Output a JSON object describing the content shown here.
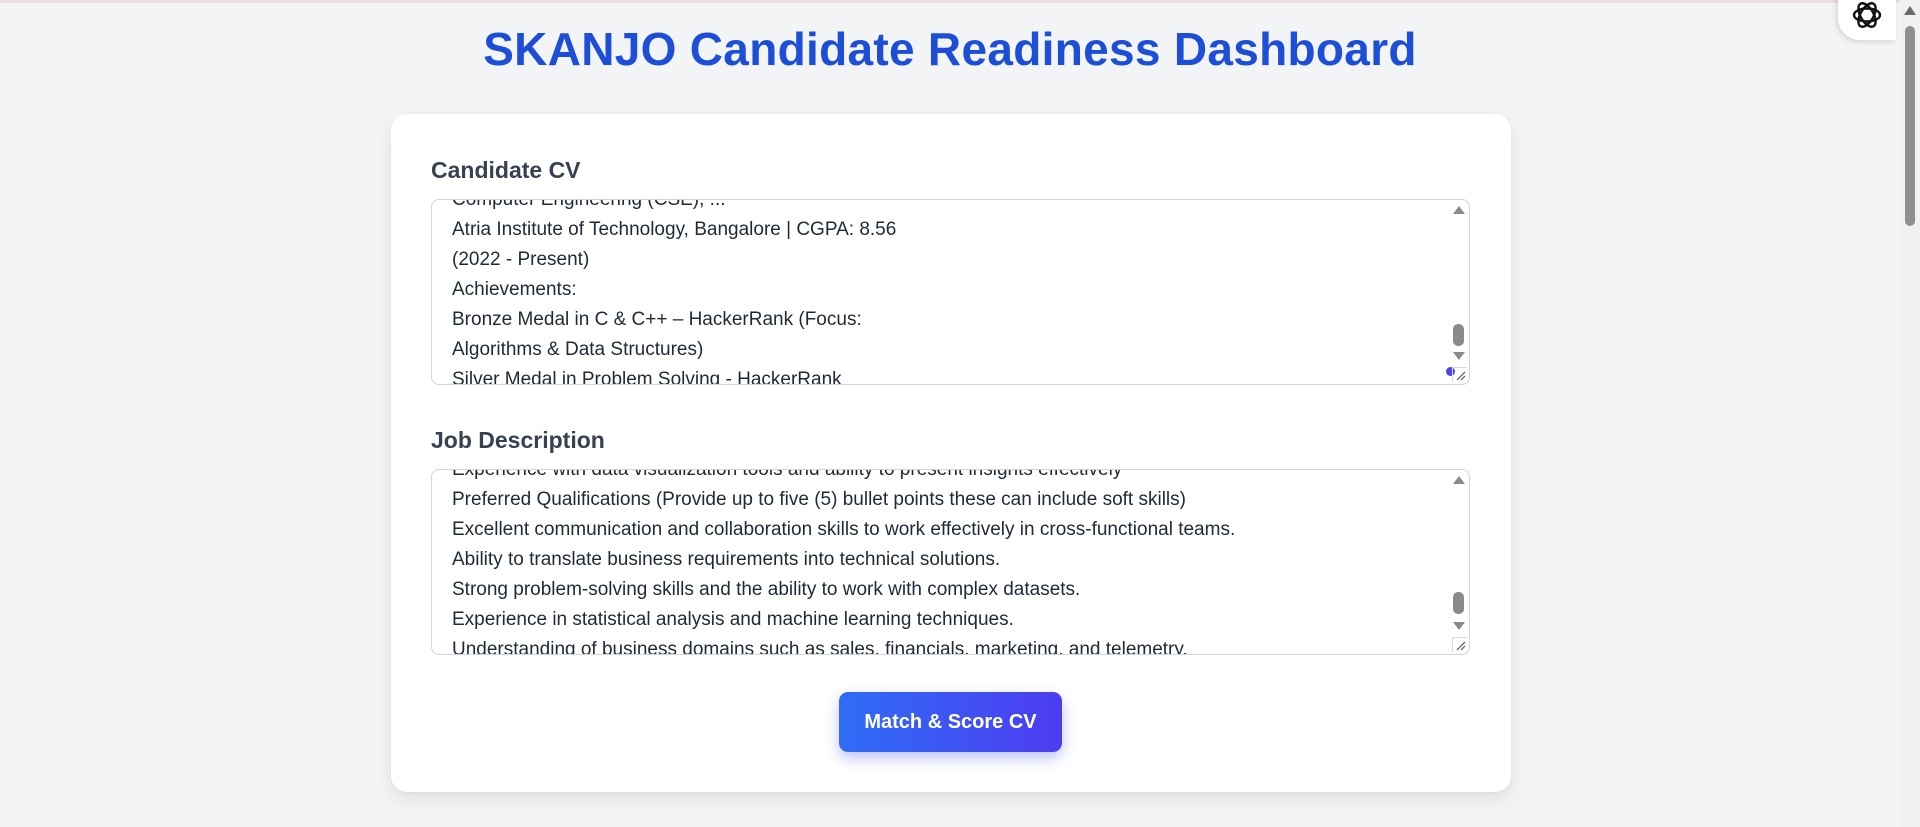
{
  "page": {
    "title": "SKANJO Candidate Readiness Dashboard"
  },
  "cv": {
    "label": "Candidate CV",
    "partial_top_line": "Computer Engineering (CSE), ...",
    "lines": [
      "Atria Institute of Technology, Bangalore | CGPA: 8.56",
      "(2022 - Present)",
      "Achievements:",
      "Bronze Medal in C & C++ – HackerRank (Focus:",
      "Algorithms & Data Structures)"
    ],
    "last_line_prefix": "Silver Medal in Problem Solving - ",
    "last_line_misspelled": "HackerRank"
  },
  "jd": {
    "label": "Job Description",
    "partial_top_line": "Experience with data visualization tools and ability to present insights effectively",
    "lines": [
      "Preferred Qualifications (Provide up to five (5) bullet points these can include soft skills)",
      "Excellent communication and collaboration skills to work effectively in cross-functional teams.",
      "Ability to translate business requirements into technical solutions.",
      "Strong problem-solving skills and the ability to work with complex datasets.",
      "Experience in statistical analysis and machine learning techniques.",
      "Understanding of business domains such as sales, financials, marketing, and telemetry."
    ]
  },
  "actions": {
    "match_label": "Match & Score CV"
  },
  "colors": {
    "title": "#1d4ed8",
    "button_start": "#2f6df6",
    "button_end": "#4c3df0"
  },
  "icons": {
    "extension": "openai-logo-icon"
  }
}
